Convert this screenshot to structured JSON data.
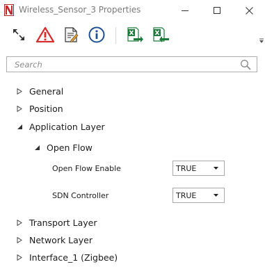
{
  "window": {
    "title": "Wireless_Sensor_3 Properties",
    "controls": {
      "minimize_icon": "minimize-icon",
      "maximize_icon": "maximize-icon",
      "close_icon": "close-icon"
    }
  },
  "toolbar": {
    "buttons": [
      {
        "icon": "expand-collapse-icon"
      },
      {
        "icon": "warning-icon"
      },
      {
        "icon": "document-edit-icon"
      },
      {
        "icon": "info-icon"
      },
      {
        "icon": "excel-export-icon"
      },
      {
        "icon": "excel-import-icon"
      }
    ],
    "colors": {
      "warning": "#d62d2d",
      "info": "#1f4f8f",
      "excel": "#1e7a3c"
    }
  },
  "search": {
    "placeholder": "Search",
    "value": ""
  },
  "tree": {
    "general": "General",
    "position": "Position",
    "application_layer": "Application Layer",
    "open_flow": "Open Flow",
    "open_flow_enable": {
      "label": "Open Flow Enable",
      "value": "TRUE",
      "options": [
        "TRUE"
      ]
    },
    "sdn_controller": {
      "label": "SDN Controller",
      "value": "TRUE",
      "options": [
        "TRUE"
      ]
    },
    "transport_layer": "Transport Layer",
    "network_layer": "Network Layer",
    "interface_1": "Interface_1 (Zigbee)"
  }
}
